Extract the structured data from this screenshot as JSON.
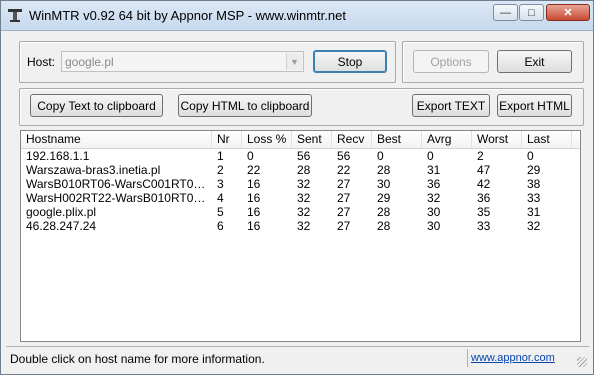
{
  "window": {
    "title": "WinMTR v0.92 64 bit by Appnor MSP - www.winmtr.net",
    "controls": {
      "minimize": "—",
      "maximize": "□",
      "close": "✕"
    }
  },
  "host": {
    "label": "Host:",
    "value": "google.pl",
    "dropdown_icon": "▼"
  },
  "buttons": {
    "stop": "Stop",
    "options": "Options",
    "exit": "Exit",
    "copy_text": "Copy Text to clipboard",
    "copy_html": "Copy HTML to clipboard",
    "export_text": "Export TEXT",
    "export_html": "Export HTML"
  },
  "table": {
    "columns": [
      "Hostname",
      "Nr",
      "Loss %",
      "Sent",
      "Recv",
      "Best",
      "Avrg",
      "Worst",
      "Last"
    ],
    "rows": [
      [
        "192.168.1.1",
        "1",
        "0",
        "56",
        "56",
        "0",
        "0",
        "2",
        "0"
      ],
      [
        "Warszawa-bras3.inetia.pl",
        "2",
        "22",
        "28",
        "22",
        "28",
        "31",
        "47",
        "29"
      ],
      [
        "WarsB010RT06-WarsC001RT04.ine...",
        "3",
        "16",
        "32",
        "27",
        "30",
        "36",
        "42",
        "38"
      ],
      [
        "WarsH002RT22-WarsB010RT06.ine...",
        "4",
        "16",
        "32",
        "27",
        "29",
        "32",
        "36",
        "33"
      ],
      [
        "google.plix.pl",
        "5",
        "16",
        "32",
        "27",
        "28",
        "30",
        "35",
        "31"
      ],
      [
        "46.28.247.24",
        "6",
        "16",
        "32",
        "27",
        "28",
        "30",
        "33",
        "32"
      ]
    ]
  },
  "status": {
    "message": "Double click on host name for more information.",
    "link": "www.appnor.com"
  }
}
